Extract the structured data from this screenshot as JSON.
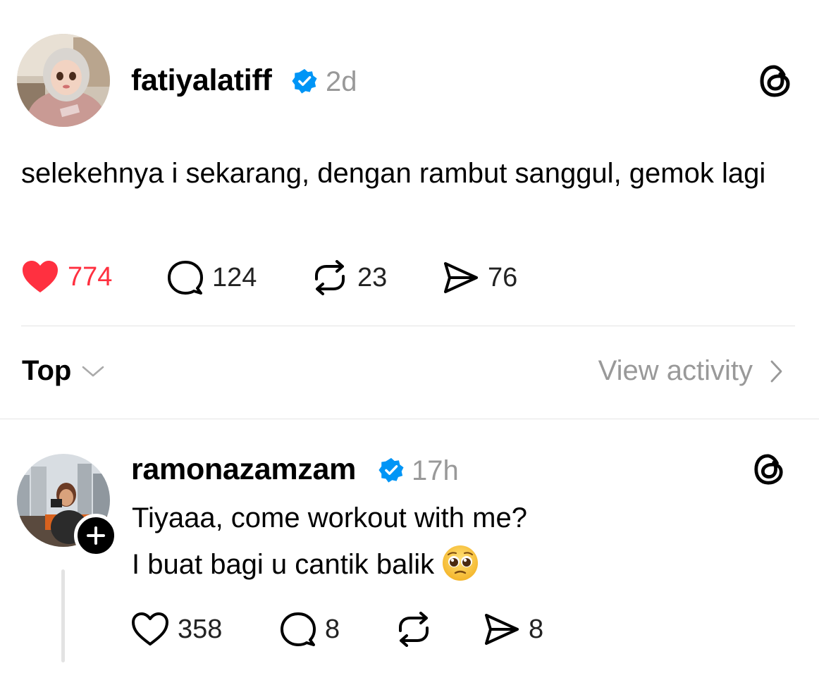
{
  "post": {
    "username": "fatiyalatiff",
    "verified": true,
    "time": "2d",
    "text": "selekehnya i sekarang, dengan rambut sanggul, gemok lagi",
    "avatar_icon": "avatar-cartoon-girl-hijab",
    "actions": {
      "likes": "774",
      "comments": "124",
      "reposts": "23",
      "shares": "76",
      "liked": true
    }
  },
  "sort": {
    "label": "Top",
    "view_activity": "View activity"
  },
  "reply": {
    "username": "ramonazamzam",
    "verified": true,
    "time": "17h",
    "lines": [
      "Tiyaaa, come workout with me?",
      "I buat bagi u cantik balik"
    ],
    "emoji": "pleading-face-emoji",
    "avatar_icon": "avatar-photo-city",
    "actions": {
      "likes": "358",
      "comments": "8",
      "reposts": "",
      "shares": "8"
    }
  },
  "colors": {
    "like_red": "#ff3040",
    "verified_blue": "#0095f6",
    "secondary_text": "#999999",
    "divider": "#e4e4e4"
  }
}
